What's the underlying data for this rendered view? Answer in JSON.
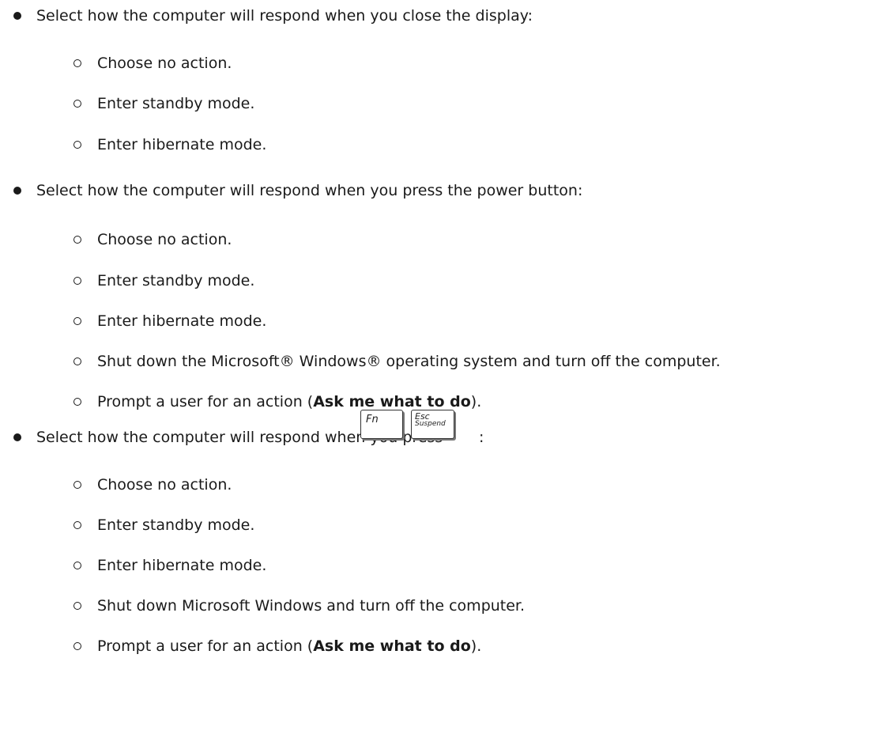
{
  "sections": [
    {
      "heading": "Select how the computer will respond when you close the display:",
      "options": [
        "Choose no action.",
        "Enter standby mode.",
        "Enter hibernate mode."
      ]
    },
    {
      "heading": "Select how the computer will respond when you press the power button:",
      "options": [
        "Choose no action.",
        "Enter standby mode.",
        "Enter hibernate mode.",
        "Shut down the Microsoft® Windows® operating system and turn off the computer."
      ],
      "prompt_option": {
        "prefix": "Prompt a user for an action (",
        "bold": "Ask me what to do",
        "suffix": ")."
      }
    },
    {
      "heading": "Select how the computer will respond when you press",
      "keys": {
        "fn_label": "Fn",
        "esc_top_label": "Esc",
        "esc_bottom_label": "Suspend"
      },
      "heading_suffix": ":",
      "options": [
        "Choose no action.",
        "Enter standby mode.",
        "Enter hibernate mode.",
        "Shut down Microsoft Windows and turn off the computer."
      ],
      "prompt_option": {
        "prefix": "Prompt a user for an action (",
        "bold": "Ask me what to do",
        "suffix": ")."
      }
    }
  ]
}
